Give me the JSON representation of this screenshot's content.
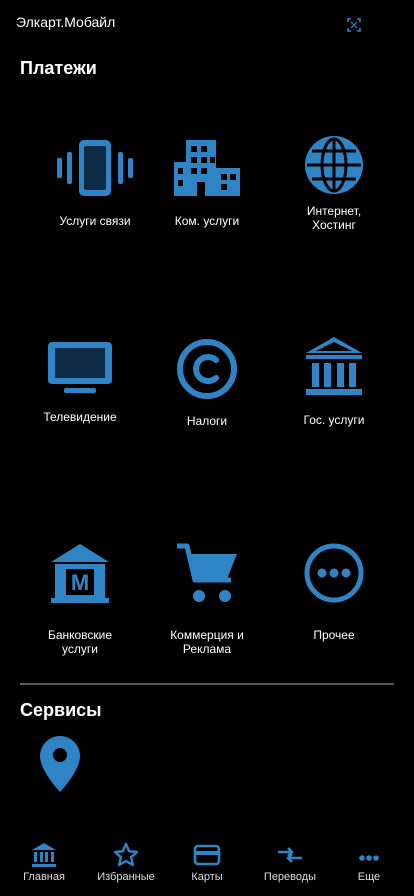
{
  "app": {
    "title": "Элкарт.Мобайл"
  },
  "colors": {
    "accent": "#2f84c6",
    "background": "#000000"
  },
  "payments": {
    "title": "Платежи",
    "items": [
      {
        "label": "Услуги связи",
        "icon": "phone-vibrate-icon"
      },
      {
        "label": "Ком. услуги",
        "icon": "buildings-icon"
      },
      {
        "label": "Интернет,\nХостинг",
        "icon": "globe-icon"
      },
      {
        "label": "Телевидение",
        "icon": "tv-icon"
      },
      {
        "label": "Налоги",
        "icon": "copyright-icon"
      },
      {
        "label": "Гос. услуги",
        "icon": "government-building-icon"
      },
      {
        "label": "Банковские\nуслуги",
        "icon": "bank-icon"
      },
      {
        "label": "Коммерция и\nРеклама",
        "icon": "shopping-cart-icon"
      },
      {
        "label": "Прочее",
        "icon": "more-dots-circle-icon"
      }
    ]
  },
  "services": {
    "title": "Сервисы",
    "items": [
      {
        "icon": "map-pin-icon"
      }
    ]
  },
  "nav": {
    "items": [
      {
        "label": "Главная",
        "icon": "bank-icon"
      },
      {
        "label": "Избранные",
        "icon": "star-icon"
      },
      {
        "label": "Карты",
        "icon": "card-icon"
      },
      {
        "label": "Переводы",
        "icon": "transfer-icon"
      },
      {
        "label": "Еще",
        "icon": "more-dots-icon"
      }
    ]
  }
}
